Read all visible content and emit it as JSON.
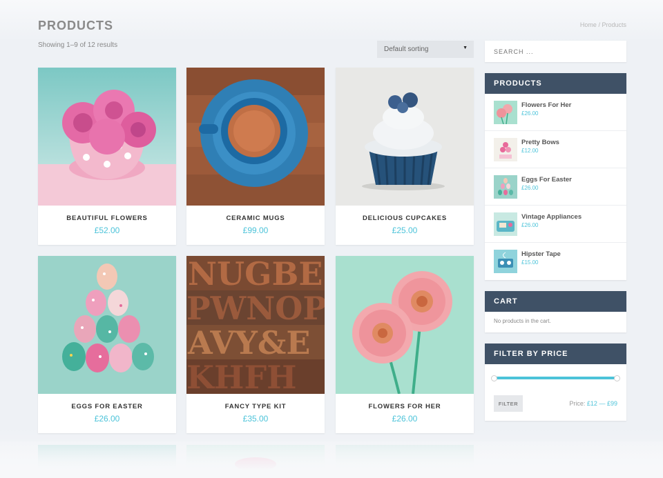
{
  "page": {
    "title": "PRODUCTS",
    "breadcrumb": {
      "home": "Home",
      "separator": "/",
      "current": "Products"
    },
    "result_count": "Showing 1–9 of 12 results",
    "sorting": "Default sorting"
  },
  "products": [
    {
      "name": "BEAUTIFUL FLOWERS",
      "price": "£52.00"
    },
    {
      "name": "CERAMIC MUGS",
      "price": "£99.00"
    },
    {
      "name": "DELICIOUS CUPCAKES",
      "price": "£25.00"
    },
    {
      "name": "EGGS FOR EASTER",
      "price": "£26.00"
    },
    {
      "name": "FANCY TYPE KIT",
      "price": "£35.00"
    },
    {
      "name": "FLOWERS FOR HER",
      "price": "£26.00"
    }
  ],
  "sidebar": {
    "search_placeholder": "SEARCH ...",
    "products_widget": {
      "title": "PRODUCTS",
      "items": [
        {
          "name": "Flowers For Her",
          "price": "£26.00"
        },
        {
          "name": "Pretty Bows",
          "price": "£12.00"
        },
        {
          "name": "Eggs For Easter",
          "price": "£26.00"
        },
        {
          "name": "Vintage Appliances",
          "price": "£26.00"
        },
        {
          "name": "Hipster Tape",
          "price": "£15.00"
        }
      ]
    },
    "cart_widget": {
      "title": "CART",
      "empty_text": "No products in the cart."
    },
    "price_filter": {
      "title": "FILTER BY PRICE",
      "button_label": "FILTER",
      "price_label": "Price:",
      "min": "£12",
      "dash": "—",
      "max": "£99",
      "range_fraction": [
        0,
        1
      ]
    }
  },
  "colors": {
    "accent": "#4cc3d9",
    "widget_header": "#3f5166"
  }
}
